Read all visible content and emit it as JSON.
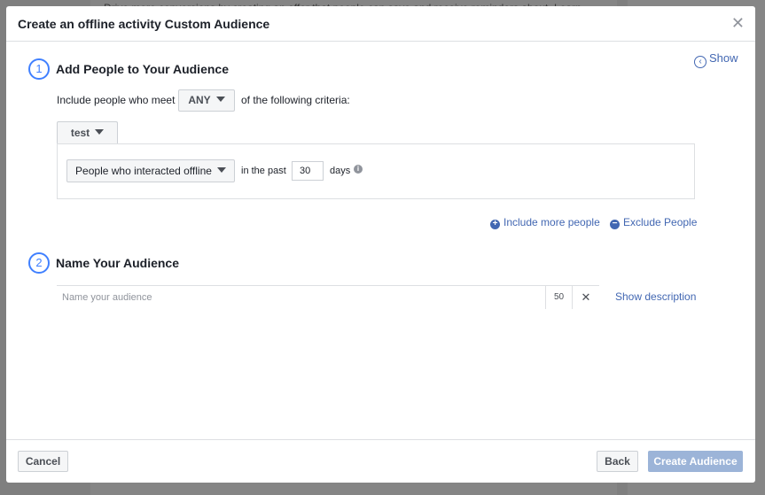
{
  "background": {
    "text": "Drive more conversions by creating an offer that people can save and receive reminders about. Learn"
  },
  "modal": {
    "title": "Create an offline activity Custom Audience",
    "show_label": "Show",
    "step1": {
      "number": "1",
      "title": "Add People to Your Audience",
      "criteria_prefix": "Include people who meet",
      "criteria_value": "ANY",
      "criteria_suffix": "of the following criteria:",
      "source": "test",
      "rule": {
        "event": "People who interacted offline",
        "in_the_past": "in the past",
        "days_value": "30",
        "days_label": "days"
      },
      "include_more": "Include more people",
      "exclude": "Exclude People"
    },
    "step2": {
      "number": "2",
      "title": "Name Your Audience",
      "name_placeholder": "Name your audience",
      "char_count": "50",
      "show_description": "Show description"
    },
    "footer": {
      "cancel": "Cancel",
      "back": "Back",
      "create": "Create Audience"
    }
  },
  "colors": {
    "accent": "#4267b2",
    "step": "#4080ff",
    "create_disabled": "#9cb4d8"
  }
}
